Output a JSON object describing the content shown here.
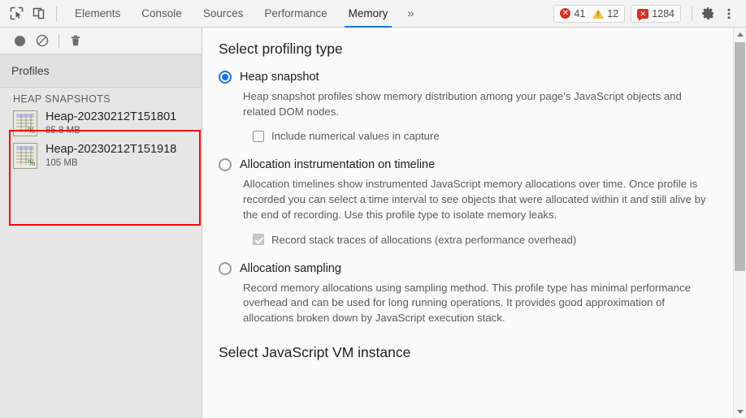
{
  "toolbar": {
    "inspect_icon": "inspect-element-icon",
    "device_icon": "device-toolbar-icon",
    "tabs": [
      {
        "label": "Elements",
        "active": false
      },
      {
        "label": "Console",
        "active": false
      },
      {
        "label": "Sources",
        "active": false
      },
      {
        "label": "Performance",
        "active": false
      },
      {
        "label": "Memory",
        "active": true
      }
    ],
    "more_tabs_glyph": "»",
    "errors_count": "41",
    "warnings_count": "12",
    "messages_count": "1284",
    "settings_icon": "gear-icon",
    "menu_icon": "kebab-menu-icon",
    "accent_color": "#1a73e8",
    "error_color": "#d93025",
    "warning_color": "#f5c043"
  },
  "sidebar": {
    "record_icon": "record-circle-icon",
    "clear_icon": "clear-no-entry-icon",
    "trash_icon": "trash-can-icon",
    "header": "Profiles",
    "group_label": "HEAP SNAPSHOTS",
    "snapshots": [
      {
        "name": "Heap-20230212T151801",
        "size": "85.8 MB"
      },
      {
        "name": "Heap-20230212T151918",
        "size": "105 MB"
      }
    ],
    "highlight_color": "#ff0000"
  },
  "main": {
    "section_title": "Select profiling type",
    "options": [
      {
        "label": "Heap snapshot",
        "selected": true,
        "description": "Heap snapshot profiles show memory distribution among your page's JavaScript objects and related DOM nodes.",
        "checkbox": {
          "label": "Include numerical values in capture",
          "checked": false,
          "disabled": false
        }
      },
      {
        "label": "Allocation instrumentation on timeline",
        "selected": false,
        "description": "Allocation timelines show instrumented JavaScript memory allocations over time. Once profile is recorded you can select a time interval to see objects that were allocated within it and still alive by the end of recording. Use this profile type to isolate memory leaks.",
        "checkbox": {
          "label": "Record stack traces of allocations (extra performance overhead)",
          "checked": true,
          "disabled": true
        }
      },
      {
        "label": "Allocation sampling",
        "selected": false,
        "description": "Record memory allocations using sampling method. This profile type has minimal performance overhead and can be used for long running operations. It provides good approximation of allocations broken down by JavaScript execution stack.",
        "checkbox": null
      }
    ],
    "vm_section_title": "Select JavaScript VM instance"
  },
  "scrollbar": {
    "up_arrow": "scroll-up-arrow-icon",
    "down_arrow": "scroll-down-arrow-icon",
    "thumb": "scrollbar-thumb"
  }
}
